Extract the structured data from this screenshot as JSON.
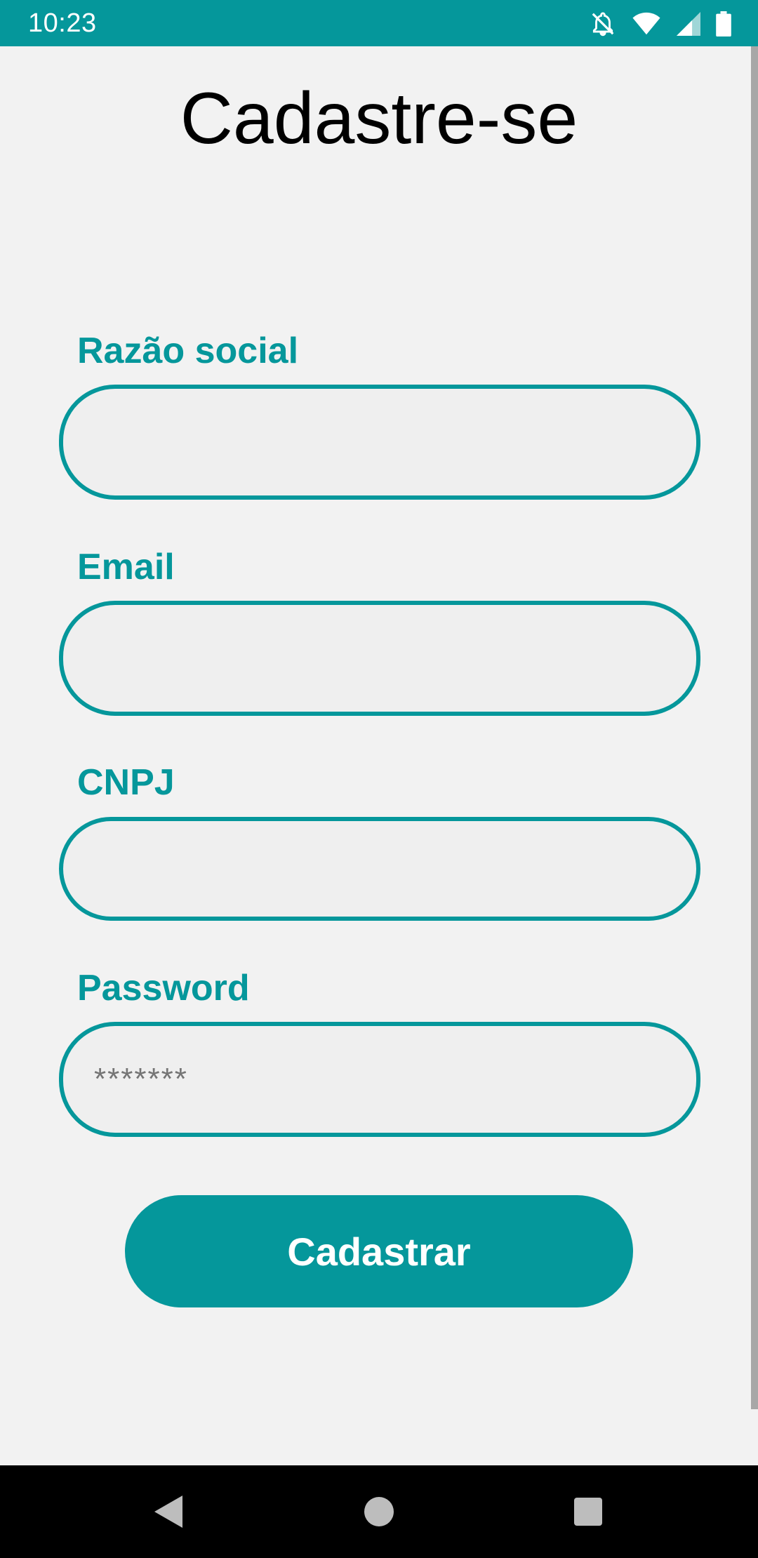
{
  "status_bar": {
    "time": "10:23",
    "background": "#05979b",
    "icons": [
      "notifications-off-icon",
      "wifi-icon",
      "signal-icon",
      "battery-icon"
    ]
  },
  "screen": {
    "title": "Cadastre-se"
  },
  "form": {
    "fields": [
      {
        "label": "Razão social",
        "value": "",
        "placeholder": ""
      },
      {
        "label": "Email",
        "value": "",
        "placeholder": ""
      },
      {
        "label": "CNPJ",
        "value": "",
        "placeholder": ""
      },
      {
        "label": "Password",
        "value": "",
        "placeholder": "*******"
      }
    ],
    "submit_label": "Cadastrar",
    "accent_color": "#05979b"
  },
  "nav_bar": {
    "buttons": [
      "back-icon",
      "home-icon",
      "recents-icon"
    ]
  }
}
